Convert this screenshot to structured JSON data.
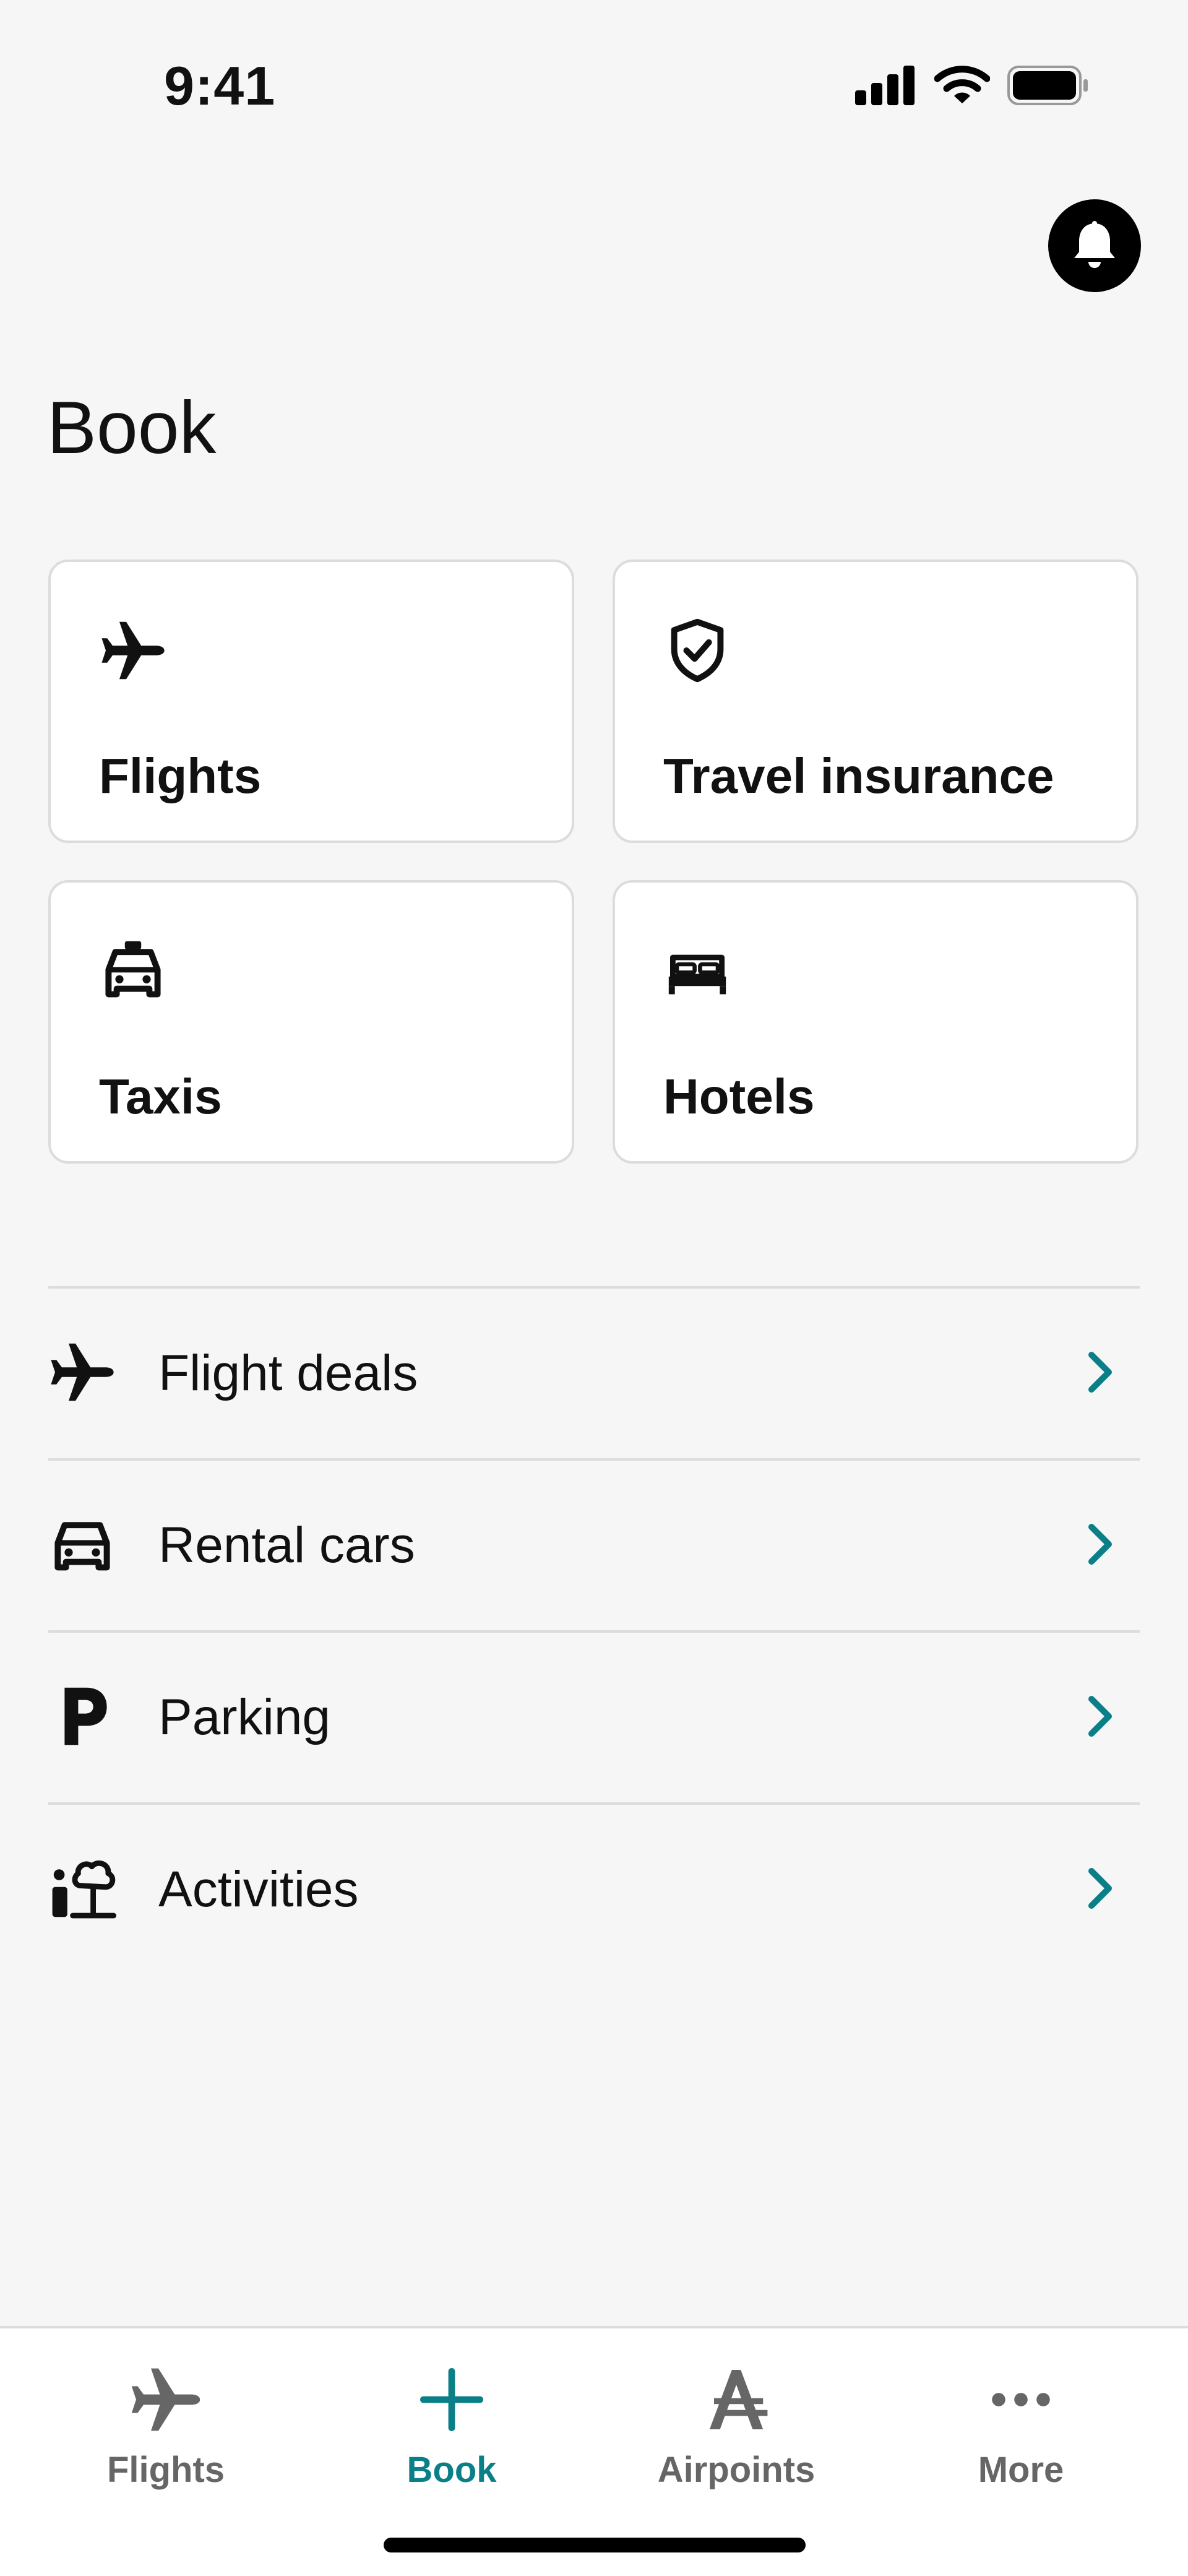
{
  "status_bar": {
    "time": "9:41"
  },
  "page": {
    "title": "Book"
  },
  "cards": [
    {
      "label": "Flights",
      "icon": "airplane-icon"
    },
    {
      "label": "Travel insurance",
      "icon": "shield-check-icon"
    },
    {
      "label": "Taxis",
      "icon": "taxi-icon"
    },
    {
      "label": "Hotels",
      "icon": "bed-icon"
    }
  ],
  "list_items": [
    {
      "label": "Flight deals",
      "icon": "airplane-icon"
    },
    {
      "label": "Rental cars",
      "icon": "car-icon"
    },
    {
      "label": "Parking",
      "icon": "parking-icon"
    },
    {
      "label": "Activities",
      "icon": "activities-icon"
    }
  ],
  "bottom_nav": [
    {
      "label": "Flights",
      "icon": "airplane-icon",
      "active": false
    },
    {
      "label": "Book",
      "icon": "plus-icon",
      "active": true
    },
    {
      "label": "Airpoints",
      "icon": "airpoints-icon",
      "active": false
    },
    {
      "label": "More",
      "icon": "more-dots-icon",
      "active": false
    }
  ],
  "colors": {
    "accent": "#0b7f88",
    "background": "#f6f6f6",
    "border": "#dcdcdc"
  }
}
